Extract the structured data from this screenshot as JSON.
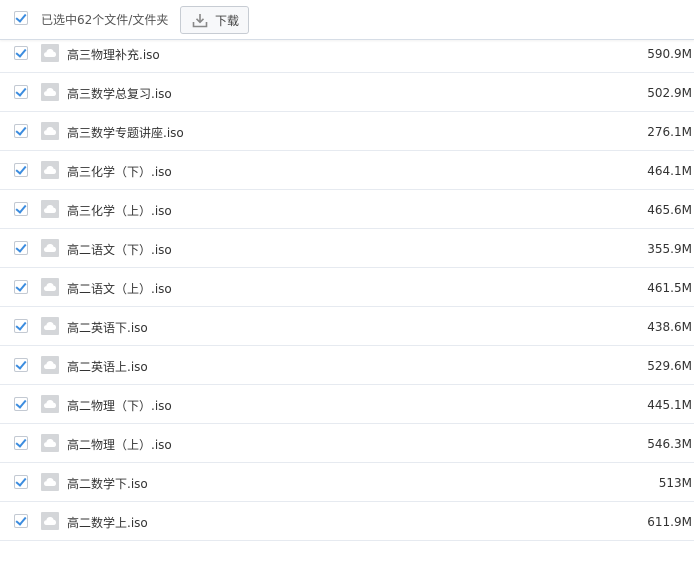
{
  "toolbar": {
    "selection_text": "已选中62个文件/文件夹",
    "download_label": "下载",
    "select_all_checked": true
  },
  "colors": {
    "accent": "#3b8cdf",
    "row_border": "#e6eaf0",
    "icon_grey": "#d4d6d9"
  },
  "files": [
    {
      "name": "",
      "ext": "",
      "size": "",
      "checked": false,
      "partial": true
    },
    {
      "name": "高三物理补充",
      "ext": ".iso",
      "size": "590.9M",
      "checked": true
    },
    {
      "name": "高三数学总复习",
      "ext": ".iso",
      "size": "502.9M",
      "checked": true
    },
    {
      "name": "高三数学专题讲座",
      "ext": ".iso",
      "size": "276.1M",
      "checked": true
    },
    {
      "name": "高三化学（下）",
      "ext": ".iso",
      "size": "464.1M",
      "checked": true
    },
    {
      "name": "高三化学（上）",
      "ext": ".iso",
      "size": "465.6M",
      "checked": true
    },
    {
      "name": "高二语文（下）",
      "ext": ".iso",
      "size": "355.9M",
      "checked": true
    },
    {
      "name": "高二语文（上）",
      "ext": ".iso",
      "size": "461.5M",
      "checked": true
    },
    {
      "name": "高二英语下",
      "ext": ".iso",
      "size": "438.6M",
      "checked": true
    },
    {
      "name": "高二英语上",
      "ext": ".iso",
      "size": "529.6M",
      "checked": true
    },
    {
      "name": "高二物理（下）",
      "ext": ".iso",
      "size": "445.1M",
      "checked": true
    },
    {
      "name": "高二物理（上）",
      "ext": ".iso",
      "size": "546.3M",
      "checked": true
    },
    {
      "name": "高二数学下",
      "ext": ".iso",
      "size": "513M",
      "checked": true
    },
    {
      "name": "高二数学上",
      "ext": ".iso",
      "size": "611.9M",
      "checked": true
    }
  ]
}
